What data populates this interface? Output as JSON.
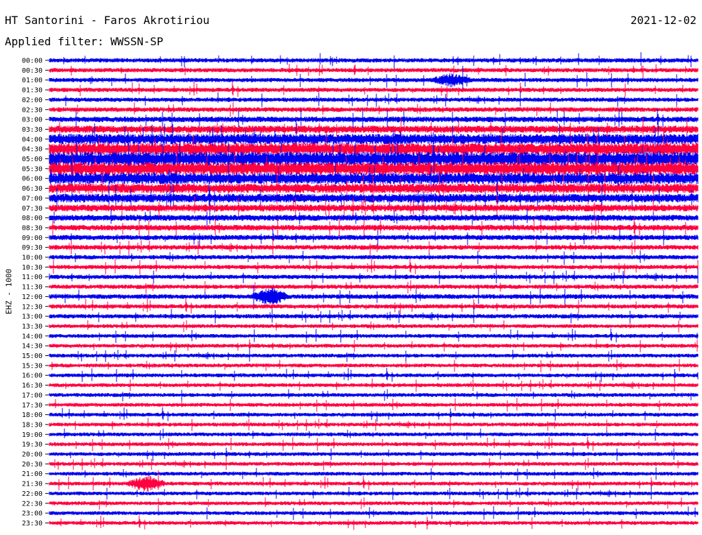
{
  "header": {
    "title": "HT Santorini - Faros Akrotiriou",
    "date": "2021-12-02",
    "filter": "Applied filter: WWSSN-SP"
  },
  "channel_label": "EHZ - 1000",
  "chart_data": {
    "type": "line",
    "title": "HT Santorini - Faros Akrotiriou",
    "date": "2021-12-02",
    "filter": "Applied filter: WWSSN-SP",
    "ylabel": "EHZ - 1000",
    "colors": [
      "#0000ee",
      "#ff0040"
    ],
    "y_tick_labels": [
      "00:00",
      "00:30",
      "01:00",
      "01:30",
      "02:00",
      "02:30",
      "03:00",
      "03:30",
      "04:00",
      "04:30",
      "05:00",
      "05:30",
      "06:00",
      "06:30",
      "07:00",
      "07:30",
      "08:00",
      "08:30",
      "09:00",
      "09:30",
      "10:00",
      "10:30",
      "11:00",
      "11:30",
      "12:00",
      "12:30",
      "13:00",
      "13:30",
      "14:00",
      "14:30",
      "15:00",
      "15:30",
      "16:00",
      "16:30",
      "17:00",
      "17:30",
      "18:00",
      "18:30",
      "19:00",
      "19:30",
      "20:00",
      "20:30",
      "21:00",
      "21:30",
      "22:00",
      "22:30",
      "23:00",
      "23:30"
    ],
    "trace_levels": [
      1.0,
      1.0,
      1.0,
      1.0,
      1.0,
      1.1,
      1.3,
      1.7,
      2.4,
      2.8,
      3.2,
      3.0,
      2.6,
      2.2,
      2.0,
      1.6,
      1.4,
      1.3,
      1.2,
      1.1,
      1.0,
      1.0,
      1.0,
      1.0,
      1.1,
      1.0,
      1.0,
      0.9,
      0.9,
      0.9,
      0.9,
      0.9,
      0.9,
      0.9,
      0.9,
      0.9,
      0.9,
      0.9,
      0.9,
      0.9,
      0.9,
      0.9,
      0.9,
      0.9,
      0.9,
      0.9,
      0.9,
      0.9
    ],
    "events": [
      {
        "trace": "01:00",
        "at": 0.62,
        "strength": 2.4
      },
      {
        "trace": "12:00",
        "at": 0.34,
        "strength": 3.2
      },
      {
        "trace": "21:30",
        "at": 0.15,
        "strength": 3.6
      }
    ],
    "grid": false
  }
}
